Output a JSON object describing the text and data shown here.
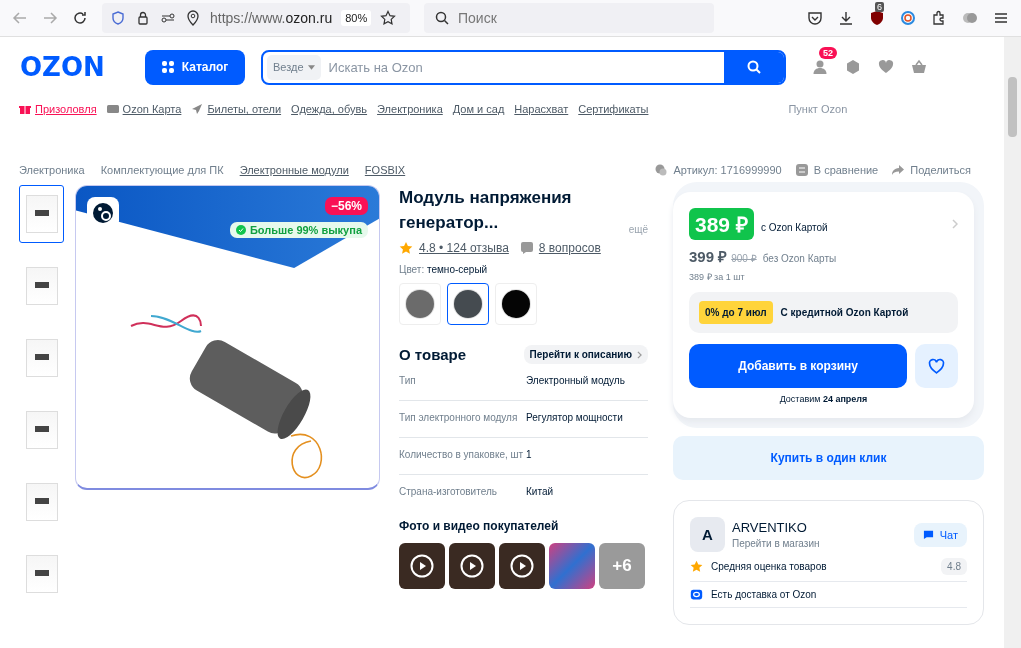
{
  "browser": {
    "url_prefix": "https://www.",
    "url_domain": "ozon.ru",
    "zoom": "80%",
    "search_placeholder": "Поиск",
    "extension_badge": "6"
  },
  "header": {
    "logo": "OZON",
    "catalog_button": "Каталог",
    "search_scope": "Везде",
    "search_placeholder": "Искать на Ozon",
    "profile_badge": "52"
  },
  "nav_links": [
    {
      "label": "Призоловля",
      "kind": "gift"
    },
    {
      "label": "Ozon Карта",
      "kind": "card"
    },
    {
      "label": "Билеты, отели",
      "kind": "plane"
    },
    {
      "label": "Одежда, обувь",
      "kind": "plain"
    },
    {
      "label": "Электроника",
      "kind": "plain"
    },
    {
      "label": "Дом и сад",
      "kind": "plain"
    },
    {
      "label": "Нарасхват",
      "kind": "plain"
    },
    {
      "label": "Сертификаты",
      "kind": "plain"
    }
  ],
  "pickup": "Пункт Ozon",
  "breadcrumbs": [
    {
      "label": "Электроника",
      "underlined": false
    },
    {
      "label": "Комплектующие для ПК",
      "underlined": false
    },
    {
      "label": "Электронные модули",
      "underlined": true
    },
    {
      "label": "FOSBIX",
      "underlined": true
    }
  ],
  "meta": {
    "article": "Артикул: 1716999990",
    "compare": "В сравнение",
    "share": "Поделиться"
  },
  "thumbnails": [
    {
      "selected": true
    },
    {
      "selected": false
    },
    {
      "selected": false
    },
    {
      "selected": false
    },
    {
      "selected": false
    },
    {
      "selected": false
    }
  ],
  "gallery": {
    "discount": "−56%",
    "badge": "Больше 99% выкупа"
  },
  "product": {
    "title": "Модуль напряжения генератор...",
    "more": "ещё",
    "rating": "4.8 • 124 отзыва",
    "questions": "8 вопросов",
    "color_label": "Цвет:",
    "color_value": "темно-серый",
    "swatches": [
      {
        "color": "#6b6b6b",
        "selected": false
      },
      {
        "color": "#454b50",
        "selected": true
      },
      {
        "color": "#050505",
        "selected": false
      }
    ]
  },
  "about": {
    "title": "О товаре",
    "link": "Перейти к описанию",
    "specs": [
      {
        "name": "Тип",
        "value": "Электронный модуль"
      },
      {
        "name": "Тип электронного модуля",
        "value": "Регулятор мощности"
      },
      {
        "name": "Количество в упаковке, шт",
        "value": "1"
      },
      {
        "name": "Страна-изготовитель",
        "value": "Китай"
      }
    ]
  },
  "customer_media": {
    "title": "Фото и видео покупателей",
    "items": [
      {
        "kind": "video"
      },
      {
        "kind": "video"
      },
      {
        "kind": "video"
      },
      {
        "kind": "photo"
      },
      {
        "kind": "more",
        "label": "+6"
      }
    ]
  },
  "price_card": {
    "price": "389 ₽",
    "price_note": "с Ozon Картой",
    "regular_price": "399 ₽",
    "old_price": "900 ₽",
    "regular_note": "без Ozon Карты",
    "unit_price": "389 ₽ за 1 шт",
    "credit_badge": "0% до 7 июл",
    "credit_text": "С кредитной Ozon Картой",
    "add_button": "Добавить в корзину",
    "delivery": "Доставим **24 апреля**"
  },
  "one_click_button": "Купить в один клик",
  "seller": {
    "initial": "A",
    "name": "ARVENTIKO",
    "link": "Перейти в магазин",
    "chat_button": "Чат",
    "features": [
      {
        "kind": "rating",
        "label": "Средняя оценка товаров",
        "value": "4.8"
      },
      {
        "kind": "delivery",
        "label": "Есть доставка от Ozon"
      }
    ]
  }
}
